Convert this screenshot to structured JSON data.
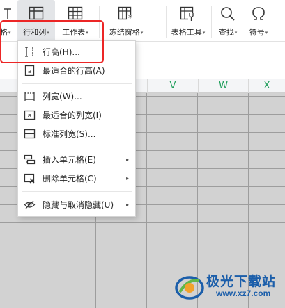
{
  "ribbon": {
    "partial_left_label": "格",
    "buttons": [
      {
        "label": "行和列",
        "icon": "row-column-icon",
        "active": true
      },
      {
        "label": "工作表",
        "icon": "worksheet-icon"
      },
      {
        "label": "冻结窗格",
        "icon": "freeze-panes-icon"
      },
      {
        "label": "表格工具",
        "icon": "table-tools-icon"
      },
      {
        "label": "查找",
        "icon": "search-icon"
      },
      {
        "label": "符号",
        "icon": "symbol-omega-icon"
      }
    ],
    "dropdown_caret": "▾"
  },
  "columns": [
    "V",
    "W",
    "X"
  ],
  "menu": {
    "items": [
      {
        "label": "行高(H)...",
        "icon": "row-height-icon"
      },
      {
        "label": "最适合的行高(A)",
        "icon": "autofit-row-icon"
      },
      {
        "label": "列宽(W)...",
        "icon": "column-width-icon"
      },
      {
        "label": "最适合的列宽(I)",
        "icon": "autofit-column-icon"
      },
      {
        "label": "标准列宽(S)...",
        "icon": "standard-width-icon"
      },
      {
        "label": "插入单元格(E)",
        "icon": "insert-cell-icon",
        "submenu": true
      },
      {
        "label": "删除单元格(C)",
        "icon": "delete-cell-icon",
        "submenu": true
      },
      {
        "label": "隐藏与取消隐藏(U)",
        "icon": "hide-unhide-icon",
        "submenu": true
      }
    ],
    "submenu_arrow": "▸"
  },
  "watermark": {
    "title": "极光下载站",
    "url": "www.xz7.com"
  },
  "colors": {
    "highlight": "#ec2626",
    "column_header_text": "#1f9e5b",
    "active_button_bg": "#e3e5e8",
    "grid_fill": "#d2d2d2",
    "watermark_blue": "#1b5eaa"
  }
}
